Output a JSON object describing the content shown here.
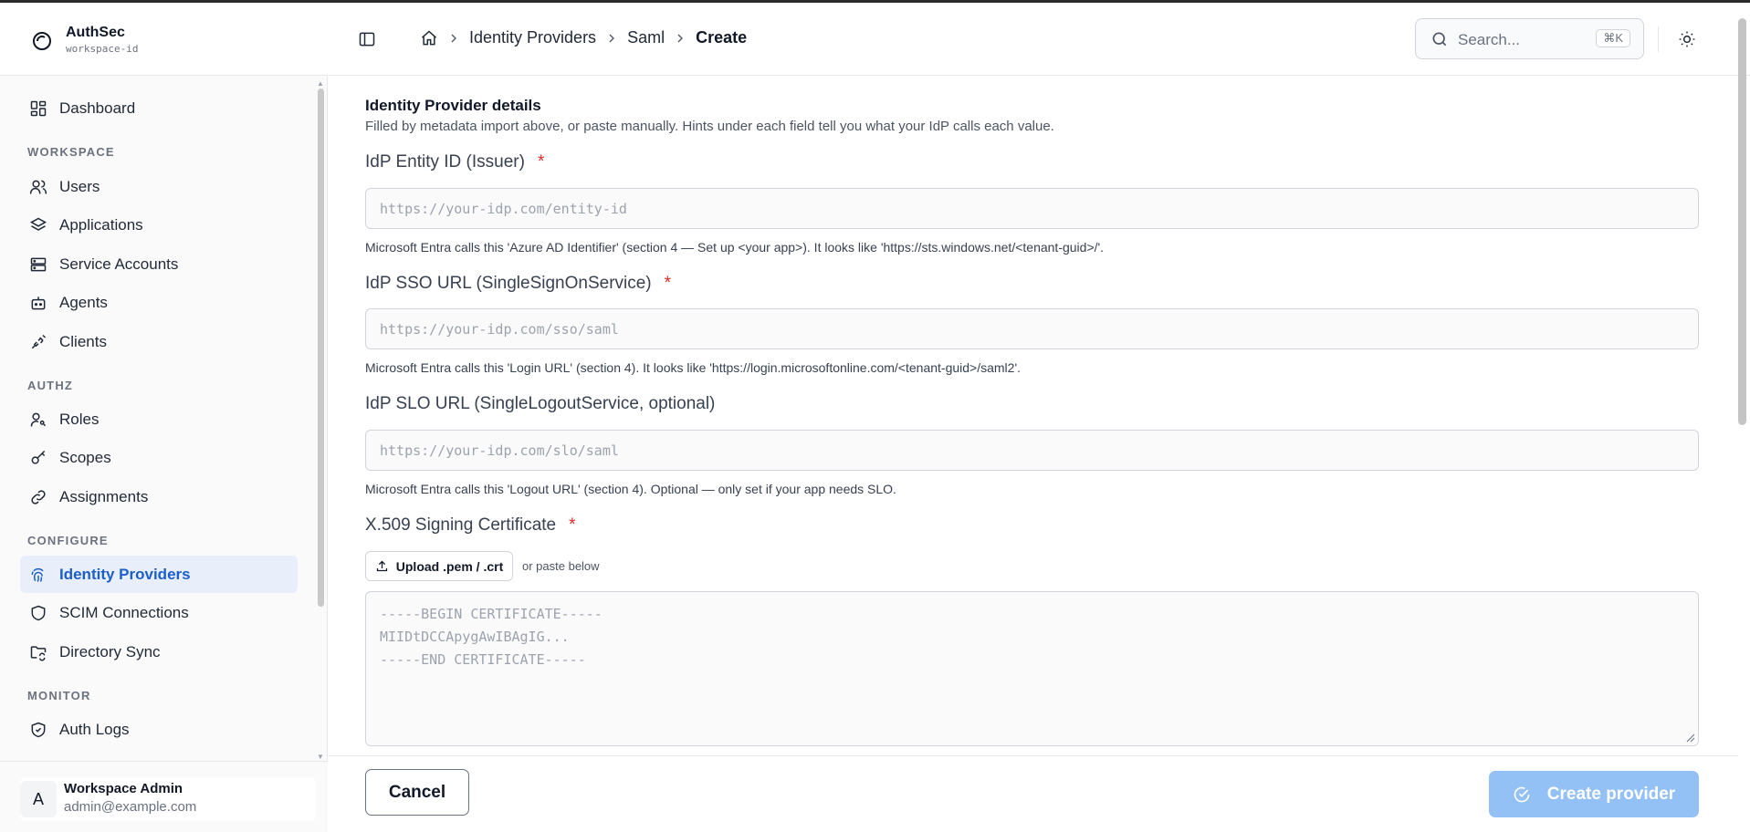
{
  "brand": {
    "name": "AuthSec",
    "workspace": "workspace-id"
  },
  "sidebar": {
    "dashboard": "Dashboard",
    "sections": {
      "workspace": "WORKSPACE",
      "authz": "AUTHZ",
      "configure": "CONFIGURE",
      "monitor": "MONITOR"
    },
    "items": {
      "users": "Users",
      "applications": "Applications",
      "service_accounts": "Service Accounts",
      "agents": "Agents",
      "clients": "Clients",
      "roles": "Roles",
      "scopes": "Scopes",
      "assignments": "Assignments",
      "identity_providers": "Identity Providers",
      "scim_connections": "SCIM Connections",
      "directory_sync": "Directory Sync",
      "auth_logs": "Auth Logs"
    },
    "active": "identity_providers"
  },
  "user": {
    "initial": "A",
    "name": "Workspace Admin",
    "email": "admin@example.com"
  },
  "header": {
    "breadcrumbs": [
      "Identity Providers",
      "Saml",
      "Create"
    ],
    "search_placeholder": "Search...",
    "search_shortcut": "⌘K"
  },
  "form": {
    "title": "Identity Provider details",
    "description": "Filled by metadata import above, or paste manually. Hints under each field tell you what your IdP calls each value.",
    "required_mark": "*",
    "entity_id": {
      "label": "IdP Entity ID (Issuer)",
      "placeholder": "https://your-idp.com/entity-id",
      "hint": "Microsoft Entra calls this 'Azure AD Identifier' (section 4 — Set up <your app>). It looks like 'https://sts.windows.net/<tenant-guid>/'."
    },
    "sso_url": {
      "label": "IdP SSO URL (SingleSignOnService)",
      "placeholder": "https://your-idp.com/sso/saml",
      "hint": "Microsoft Entra calls this 'Login URL' (section 4). It looks like 'https://login.microsoftonline.com/<tenant-guid>/saml2'."
    },
    "slo_url": {
      "label": "IdP SLO URL (SingleLogoutService, optional)",
      "placeholder": "https://your-idp.com/slo/saml",
      "hint": "Microsoft Entra calls this 'Logout URL' (section 4). Optional — only set if your app needs SLO."
    },
    "certificate": {
      "label": "X.509 Signing Certificate",
      "upload_label": "Upload .pem / .crt",
      "paste_note": "or paste below",
      "placeholder_lines": [
        "-----BEGIN CERTIFICATE-----",
        "MIIDtDCCApygAwIBAgIG...",
        "-----END CERTIFICATE-----"
      ]
    }
  },
  "footer": {
    "cancel": "Cancel",
    "create": "Create provider"
  },
  "colors": {
    "accent": "#1d5fc9",
    "active_bg": "#e8effb",
    "create_btn": "#93c1f5",
    "required": "#dc2626"
  }
}
